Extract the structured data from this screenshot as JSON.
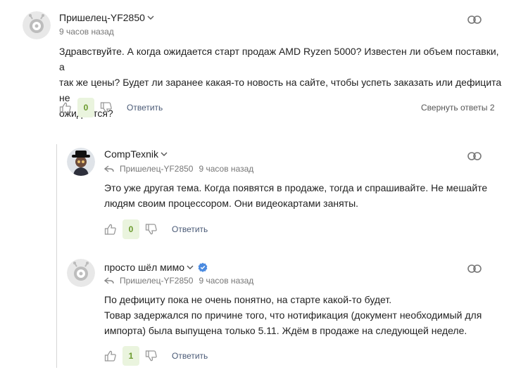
{
  "comments": [
    {
      "author": "Пришелец-YF2850",
      "time": "9 часов назад",
      "text": [
        "Здравствуйте. А когда ожидается старт продаж AMD Ryzen 5000?  Известен ли объем поставки, а",
        "так же цены? Будет ли заранее какая-то новость на сайте, чтобы успеть заказать или дефицита не",
        "ожидается?"
      ],
      "score": "0",
      "reply_label": "Ответить",
      "collapse_label": "Свернуть ответы 2"
    },
    {
      "author": "CompTexnik",
      "reply_to": "Пришелец-YF2850",
      "time": "9 часов назад",
      "text": [
        "Это уже другая тема. Когда появятся в продаже, тогда и спрашивайте. Не мешайте",
        "людям своим процессором. Они видеокартами заняты."
      ],
      "score": "0",
      "reply_label": "Ответить"
    },
    {
      "author": "просто шёл мимо",
      "reply_to": "Пришелец-YF2850",
      "time": "9 часов назад",
      "text": [
        "По дефициту пока не очень понятно, на старте какой-то будет.",
        "Товар задержался по причине того, что нотификация (документ необходимый для",
        "импорта) была выпущена только 5.11. Ждём в продаже на следующей неделе."
      ],
      "score": "1",
      "reply_label": "Ответить"
    }
  ],
  "colors": {
    "score_bg": "#eaf4de",
    "score_text": "#6a9a2c",
    "verified": "#4a8ae0",
    "reply_link": "#4a5a76"
  },
  "icons": [
    "alien-avatar-icon",
    "user-photo-avatar",
    "chevron-down-icon",
    "verified-icon",
    "link-icon",
    "thumb-up-icon",
    "thumb-down-icon",
    "reply-arrow-icon"
  ]
}
